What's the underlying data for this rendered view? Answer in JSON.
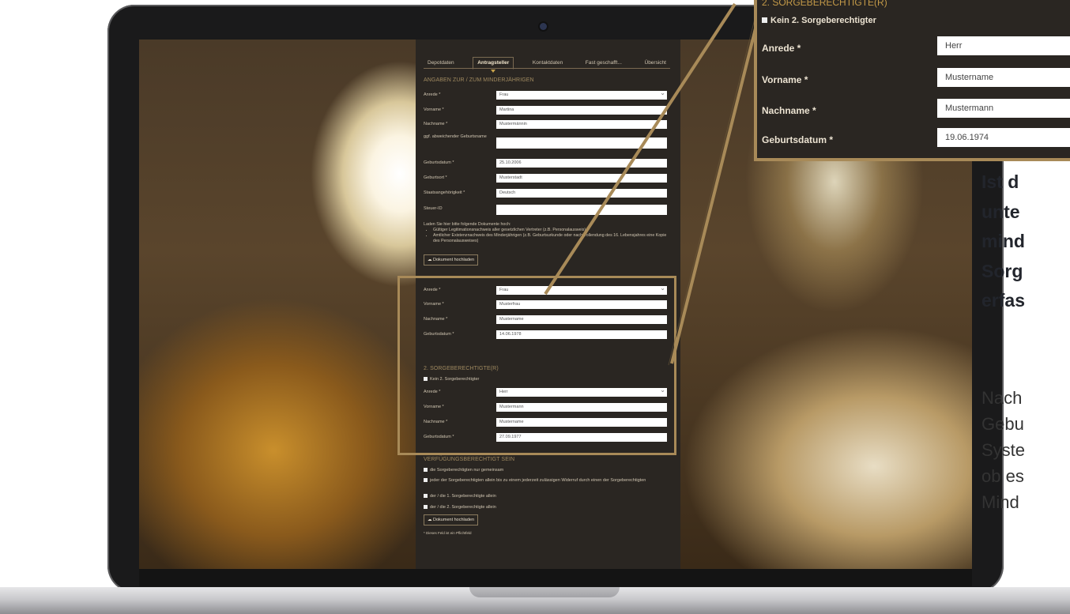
{
  "form": {
    "tabs": [
      {
        "label": "Depotdaten"
      },
      {
        "label": "Antragsteller",
        "active": true
      },
      {
        "label": "Kontaktdaten"
      },
      {
        "label": "Fast geschafft..."
      },
      {
        "label": "Übersicht"
      }
    ],
    "minor_section_title": "ANGABEN ZUR / ZUM MINDERJÄHRIGEN",
    "minor_fields": [
      {
        "label": "Anrede *",
        "value": "Frau",
        "type": "select"
      },
      {
        "label": "Vorname *",
        "value": "Martina"
      },
      {
        "label": "Nachname *",
        "value": "Mustermännin"
      },
      {
        "label": "ggf. abweichender Geburtsname",
        "value": ""
      },
      {
        "label": "Geburtsdatum *",
        "value": "25.10.2006"
      },
      {
        "label": "Geburtsort *",
        "value": "Musterstadt"
      },
      {
        "label": "Staatsangehörigkeit *",
        "value": "Deutsch"
      },
      {
        "label": "Steuer-ID",
        "value": ""
      }
    ],
    "upload_note_intro": "Laden Sie hier bitte folgende Dokumente hoch:",
    "upload_note_items": [
      "Gültiger Legitimationsnachweis aller gesetzlichen Vertreter (z.B. Personalausweis)",
      "Amtlicher Existenznachweis des Minderjährigen (z.B. Geburtsurkunde oder nach Vollendung des 16. Lebensjahres eine Kopie des Personalausweises)"
    ],
    "upload_button": "Dokument hochladen",
    "guardian1_fields": [
      {
        "label": "Anrede *",
        "value": "Frau",
        "type": "select"
      },
      {
        "label": "Vorname *",
        "value": "Musterfrau"
      },
      {
        "label": "Nachname *",
        "value": "Mustername"
      },
      {
        "label": "Geburtsdatum *",
        "value": "14.06.1978"
      }
    ],
    "guardian2_title": "2. SORGEBERECHTIGTE(R)",
    "guardian2_checkbox": "Kein 2. Sorgeberechtigter",
    "guardian2_fields": [
      {
        "label": "Anrede *",
        "value": "Herr",
        "type": "select"
      },
      {
        "label": "Vorname *",
        "value": "Mustermann"
      },
      {
        "label": "Nachname *",
        "value": "Mustername"
      },
      {
        "label": "Geburtsdatum *",
        "value": "27.09.1977"
      }
    ],
    "authority_title": "VERFÜGUNGSBERECHTIGT SEIN",
    "authority_options": [
      "die Sorgeberechtigten nur gemeinsam",
      "jeder der Sorgeberechtigten allein bis zu einem jederzeit zulässigen Widerruf durch einen der Sorgeberechtigten",
      "der / die 1. Sorgeberechtigte allein",
      "der / die 2. Sorgeberechtigte allein"
    ],
    "upload_button_2": "Dokument hochladen",
    "required_note": "* Dieses Feld ist ein Pflichtfeld"
  },
  "callout": {
    "title": "2. SORGEBERECHTIGTE(R)",
    "checkbox": "Kein 2. Sorgeberechtigter",
    "fields": [
      {
        "label": "Anrede *",
        "value": "Herr"
      },
      {
        "label": "Vorname *",
        "value": "Mustername"
      },
      {
        "label": "Nachname *",
        "value": "Mustermann"
      },
      {
        "label": "Geburtsdatum *",
        "value": "19.06.1974"
      }
    ]
  },
  "text": {
    "heading": "Ist d\nunte\nmind\nSorg\nerfas",
    "body": "Nach\nGebu\nSyste\nob es\nMind"
  },
  "colors": {
    "accent": "#a88a58",
    "panel": "#2a2622",
    "section": "#a08a60"
  },
  "icons": {
    "upload": "cloud-upload-icon",
    "camera": "camera-icon",
    "select": "chevron-down-icon"
  }
}
